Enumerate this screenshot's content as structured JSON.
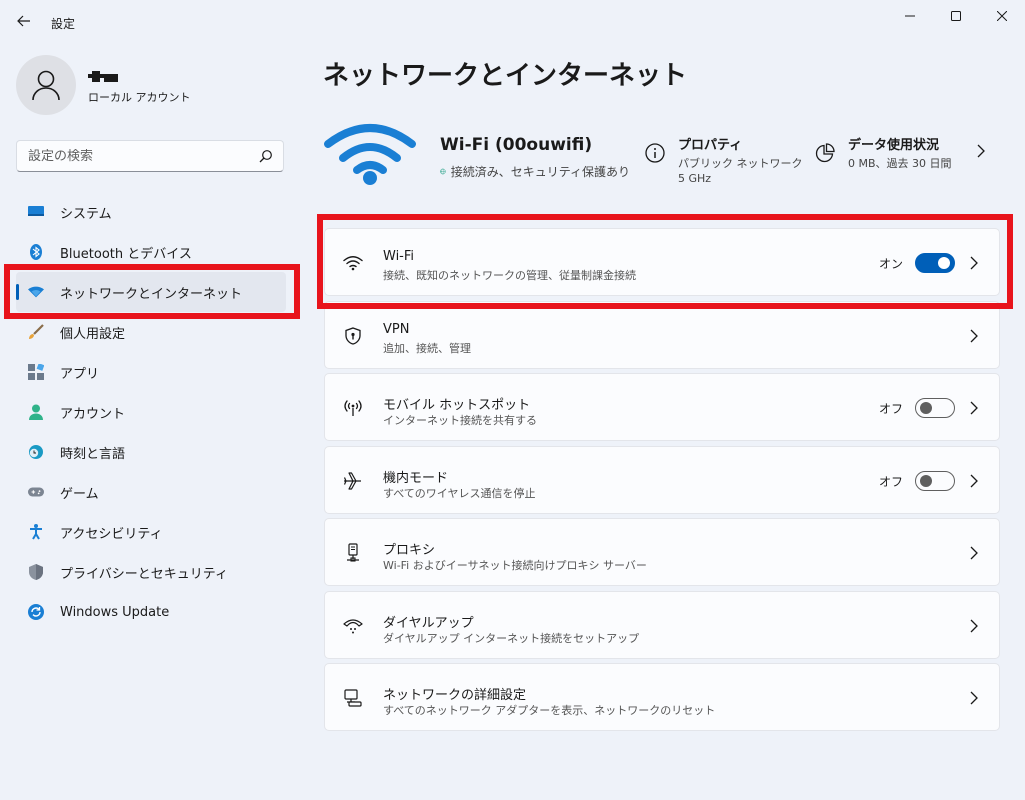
{
  "window": {
    "app_title": "設定",
    "controls": {
      "minimize": "─",
      "maximize": "☐",
      "close": "✕"
    }
  },
  "user": {
    "account_type": "ローカル アカウント"
  },
  "search": {
    "placeholder": "設定の検索"
  },
  "sidebar": {
    "items": [
      {
        "label": "システム",
        "icon": "system-icon"
      },
      {
        "label": "Bluetooth とデバイス",
        "icon": "bluetooth-icon"
      },
      {
        "label": "ネットワークとインターネット",
        "icon": "network-icon",
        "active": true
      },
      {
        "label": "個人用設定",
        "icon": "brush-icon"
      },
      {
        "label": "アプリ",
        "icon": "apps-icon"
      },
      {
        "label": "アカウント",
        "icon": "account-icon"
      },
      {
        "label": "時刻と言語",
        "icon": "clock-globe-icon"
      },
      {
        "label": "ゲーム",
        "icon": "gamepad-icon"
      },
      {
        "label": "アクセシビリティ",
        "icon": "accessibility-icon"
      },
      {
        "label": "プライバシーとセキュリティ",
        "icon": "shield-icon"
      },
      {
        "label": "Windows Update",
        "icon": "update-icon"
      }
    ]
  },
  "main": {
    "title": "ネットワークとインターネット",
    "hero": {
      "network_name": "Wi-Fi (00ouwifi)",
      "status": "接続済み、セキュリティ保護あり",
      "properties": {
        "title": "プロパティ",
        "line1": "パブリック ネットワーク",
        "line2": "5 GHz"
      },
      "usage": {
        "title": "データ使用状況",
        "line1": "0 MB、過去 30 日間"
      }
    },
    "cards": [
      {
        "title": "Wi-Fi",
        "subtitle": "接続、既知のネットワークの管理、従量制課金接続",
        "icon": "wifi-icon",
        "toggle": "オン",
        "toggle_state": "on"
      },
      {
        "title": "VPN",
        "subtitle": "追加、接続、管理",
        "icon": "vpn-shield-icon"
      },
      {
        "title": "モバイル ホットスポット",
        "subtitle": "インターネット接続を共有する",
        "icon": "hotspot-icon",
        "toggle": "オフ",
        "toggle_state": "off"
      },
      {
        "title": "機内モード",
        "subtitle": "すべてのワイヤレス通信を停止",
        "icon": "airplane-icon",
        "toggle": "オフ",
        "toggle_state": "off"
      },
      {
        "title": "プロキシ",
        "subtitle": "Wi-Fi およびイーサネット接続向けプロキシ サーバー",
        "icon": "proxy-icon"
      },
      {
        "title": "ダイヤルアップ",
        "subtitle": "ダイヤルアップ インターネット接続をセットアップ",
        "icon": "dialup-icon"
      },
      {
        "title": "ネットワークの詳細設定",
        "subtitle": "すべてのネットワーク アダプターを表示、ネットワークのリセット",
        "icon": "advanced-network-icon"
      }
    ]
  },
  "colors": {
    "accent": "#005fb8",
    "highlight": "#e8141c",
    "background": "#eef2f9",
    "card": "#fbfcfe"
  }
}
